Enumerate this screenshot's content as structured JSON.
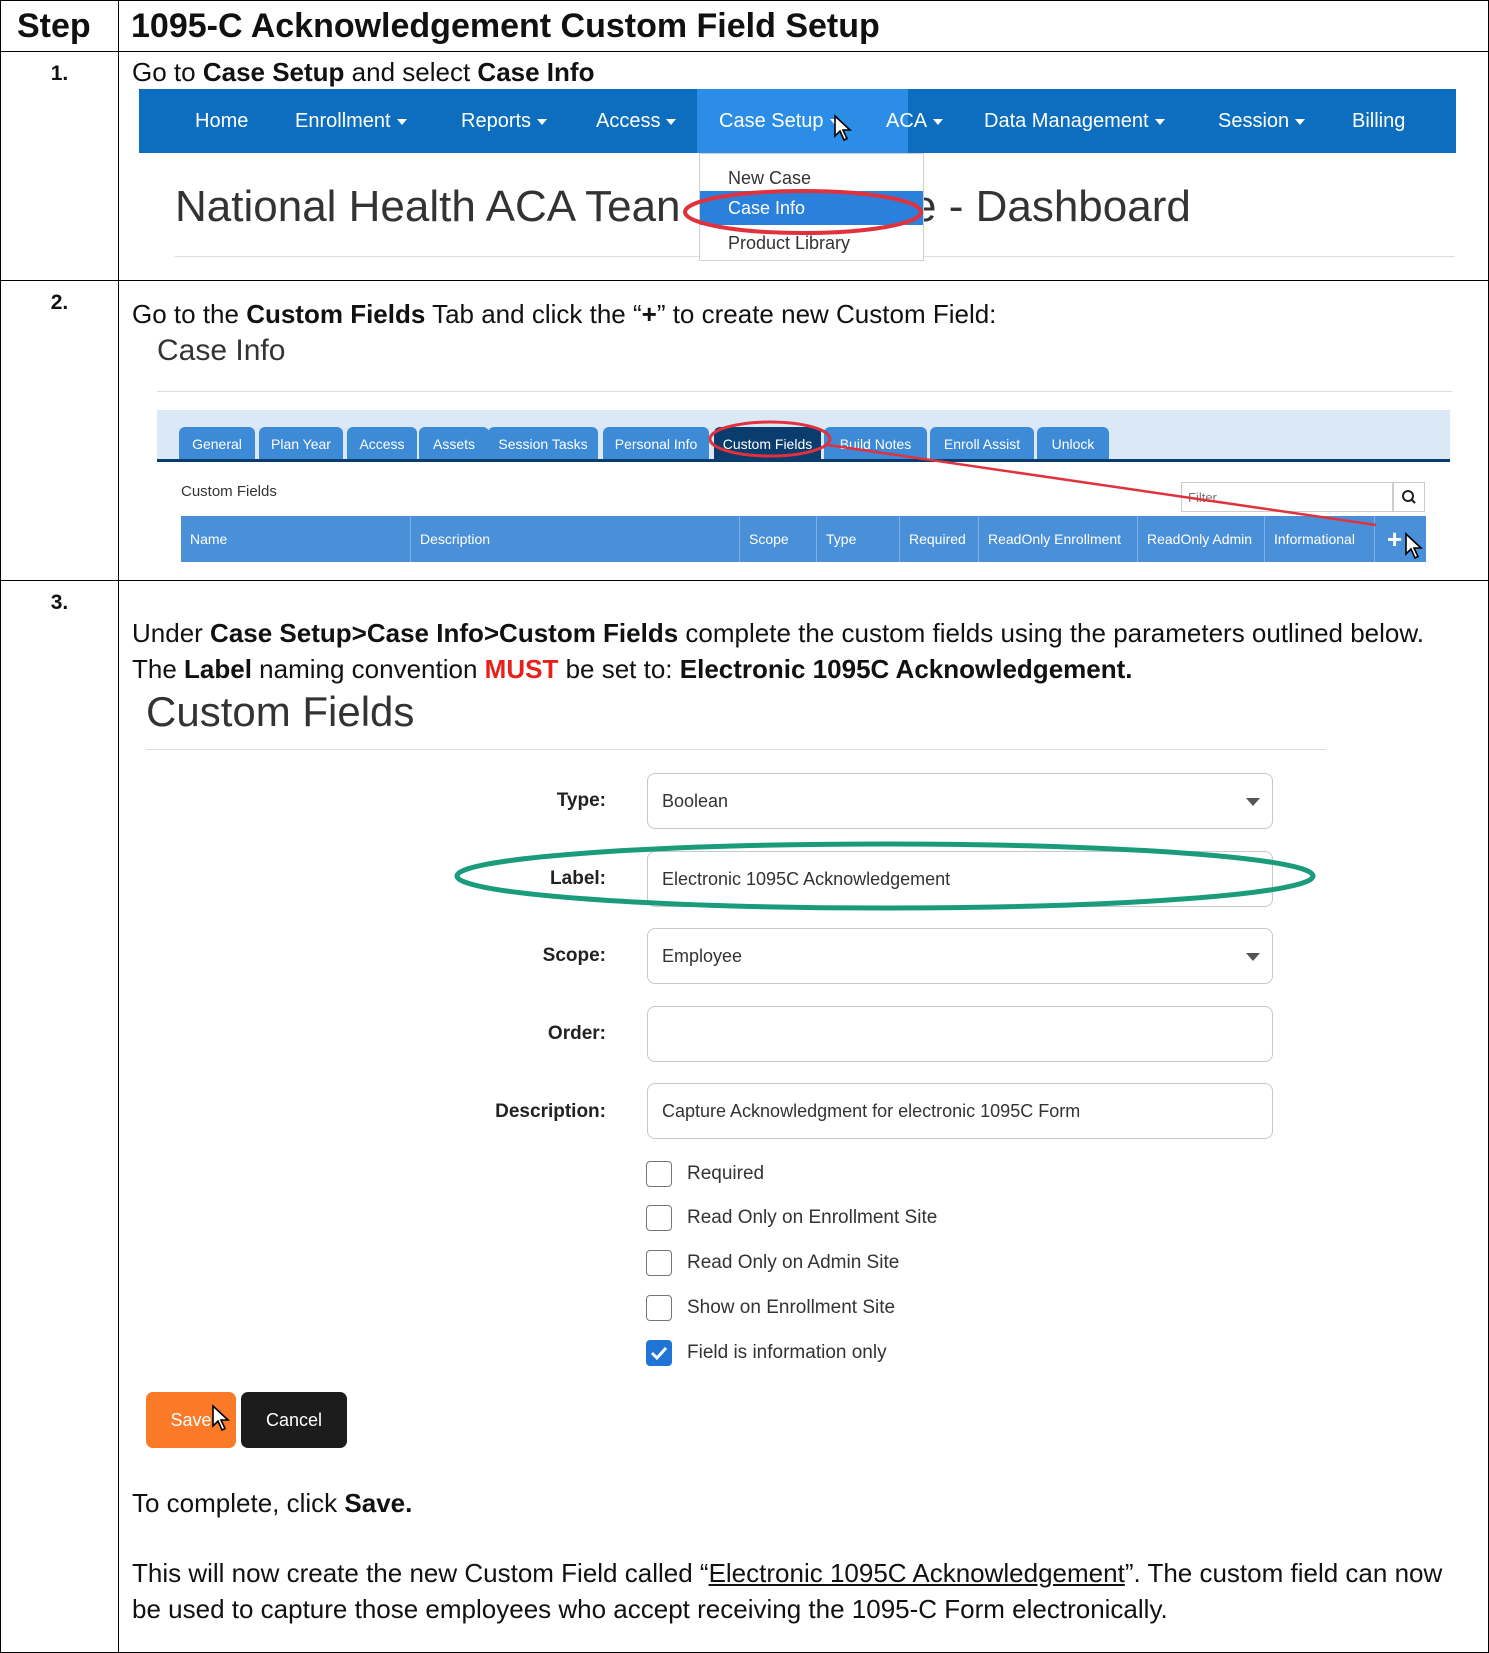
{
  "header": {
    "step": "Step",
    "title": "1095-C Acknowledgement Custom Field Setup"
  },
  "step1": {
    "number": "1.",
    "instr": {
      "pre": "Go to ",
      "b1": "Case Setup",
      "mid": " and select ",
      "b2": "Case Info"
    },
    "nav": [
      "Home",
      "Enrollment",
      "Reports",
      "Access",
      "Case Setup",
      "ACA",
      "Data Management",
      "Session",
      "Billing"
    ],
    "dropdown": [
      "New Case",
      "Case Info",
      "Product Library"
    ],
    "page_title_left": "National Health ACA Tean",
    "page_title_right": "e - Dashboard"
  },
  "step2": {
    "number": "2.",
    "instr": {
      "pre": "Go to the ",
      "b1": "Custom Fields",
      "mid": " Tab and click the “",
      "b2": "+",
      "post": "” to create new Custom Field:"
    },
    "page_title": "Case Info",
    "tabs": [
      "General",
      "Plan Year",
      "Access",
      "Assets",
      "Session Tasks",
      "Personal Info",
      "Custom Fields",
      "Build Notes",
      "Enroll Assist",
      "Unlock"
    ],
    "section_label": "Custom Fields",
    "filter_placeholder": "Filter",
    "columns": [
      "Name",
      "Description",
      "Scope",
      "Type",
      "Required",
      "ReadOnly Enrollment",
      "ReadOnly Admin",
      "Informational"
    ],
    "add_symbol": "+"
  },
  "step3": {
    "number": "3.",
    "instr": {
      "pre": "Under ",
      "b1": "Case Setup>Case Info>Custom Fields",
      "mid": " complete the custom fields using the parameters outlined below.  The ",
      "b2": "Label",
      "mid2": " naming convention ",
      "must": "MUST",
      "mid3": " be set to: ",
      "b3": "Electronic 1095C Acknowledgement."
    },
    "form_title": "Custom Fields",
    "fields": {
      "type": {
        "label": "Type:",
        "value": "Boolean"
      },
      "label": {
        "label": "Label:",
        "value": "Electronic 1095C Acknowledgement"
      },
      "scope": {
        "label": "Scope:",
        "value": "Employee"
      },
      "order": {
        "label": "Order:",
        "value": ""
      },
      "description": {
        "label": "Description:",
        "value": "Capture Acknowledgment for electronic 1095C Form"
      }
    },
    "checkboxes": [
      {
        "label": "Required",
        "checked": false
      },
      {
        "label": "Read Only on Enrollment Site",
        "checked": false
      },
      {
        "label": "Read Only on Admin Site",
        "checked": false
      },
      {
        "label": "Show on Enrollment Site",
        "checked": false
      },
      {
        "label": "Field is information only",
        "checked": true
      }
    ],
    "save_label": "Save",
    "cancel_label": "Cancel",
    "complete": {
      "pre": "To complete, click ",
      "b": "Save."
    },
    "result": {
      "pre": "This will now create the new Custom Field called “",
      "link": "Electronic 1095C Acknowledgement",
      "post": "”.   The custom field can now be used to capture those employees who accept receiving the 1095-C Form electronically."
    }
  },
  "colors": {
    "nav": "#0d6ebf",
    "tab": "#3d8ad6",
    "tab_active": "#0a3c6e",
    "save": "#fa7a27",
    "cancel": "#1c1c1c",
    "must": "#e8201b",
    "highlight_red": "#e0323c",
    "highlight_green": "#1a9b7b"
  }
}
